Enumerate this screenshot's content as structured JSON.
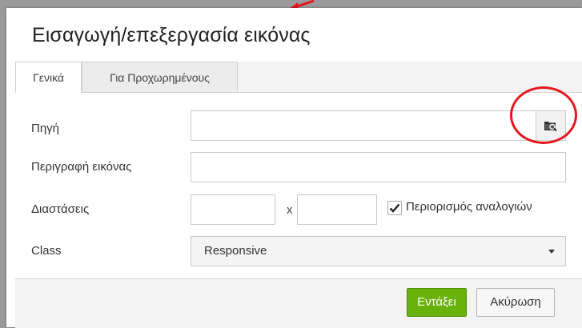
{
  "dialog": {
    "title": "Εισαγωγή/επεξεργασία εικόνας",
    "tabs": [
      {
        "label": "Γενικά",
        "active": true
      },
      {
        "label": "Για Προχωρημένους",
        "active": false
      }
    ],
    "fields": {
      "source": {
        "label": "Πηγή",
        "value": "",
        "browse_icon": "folder-search-icon"
      },
      "description": {
        "label": "Περιγραφή εικόνας",
        "value": ""
      },
      "dimensions": {
        "label": "Διαστάσεις",
        "width": "",
        "height": "",
        "separator": "x",
        "constrain_label": "Περιορισμός αναλογιών",
        "constrain_checked": true
      },
      "class": {
        "label": "Class",
        "value": "Responsive"
      }
    },
    "buttons": {
      "ok": "Εντάξει",
      "cancel": "Ακύρωση"
    }
  },
  "annotations": {
    "highlight_color": "#e5161d"
  }
}
